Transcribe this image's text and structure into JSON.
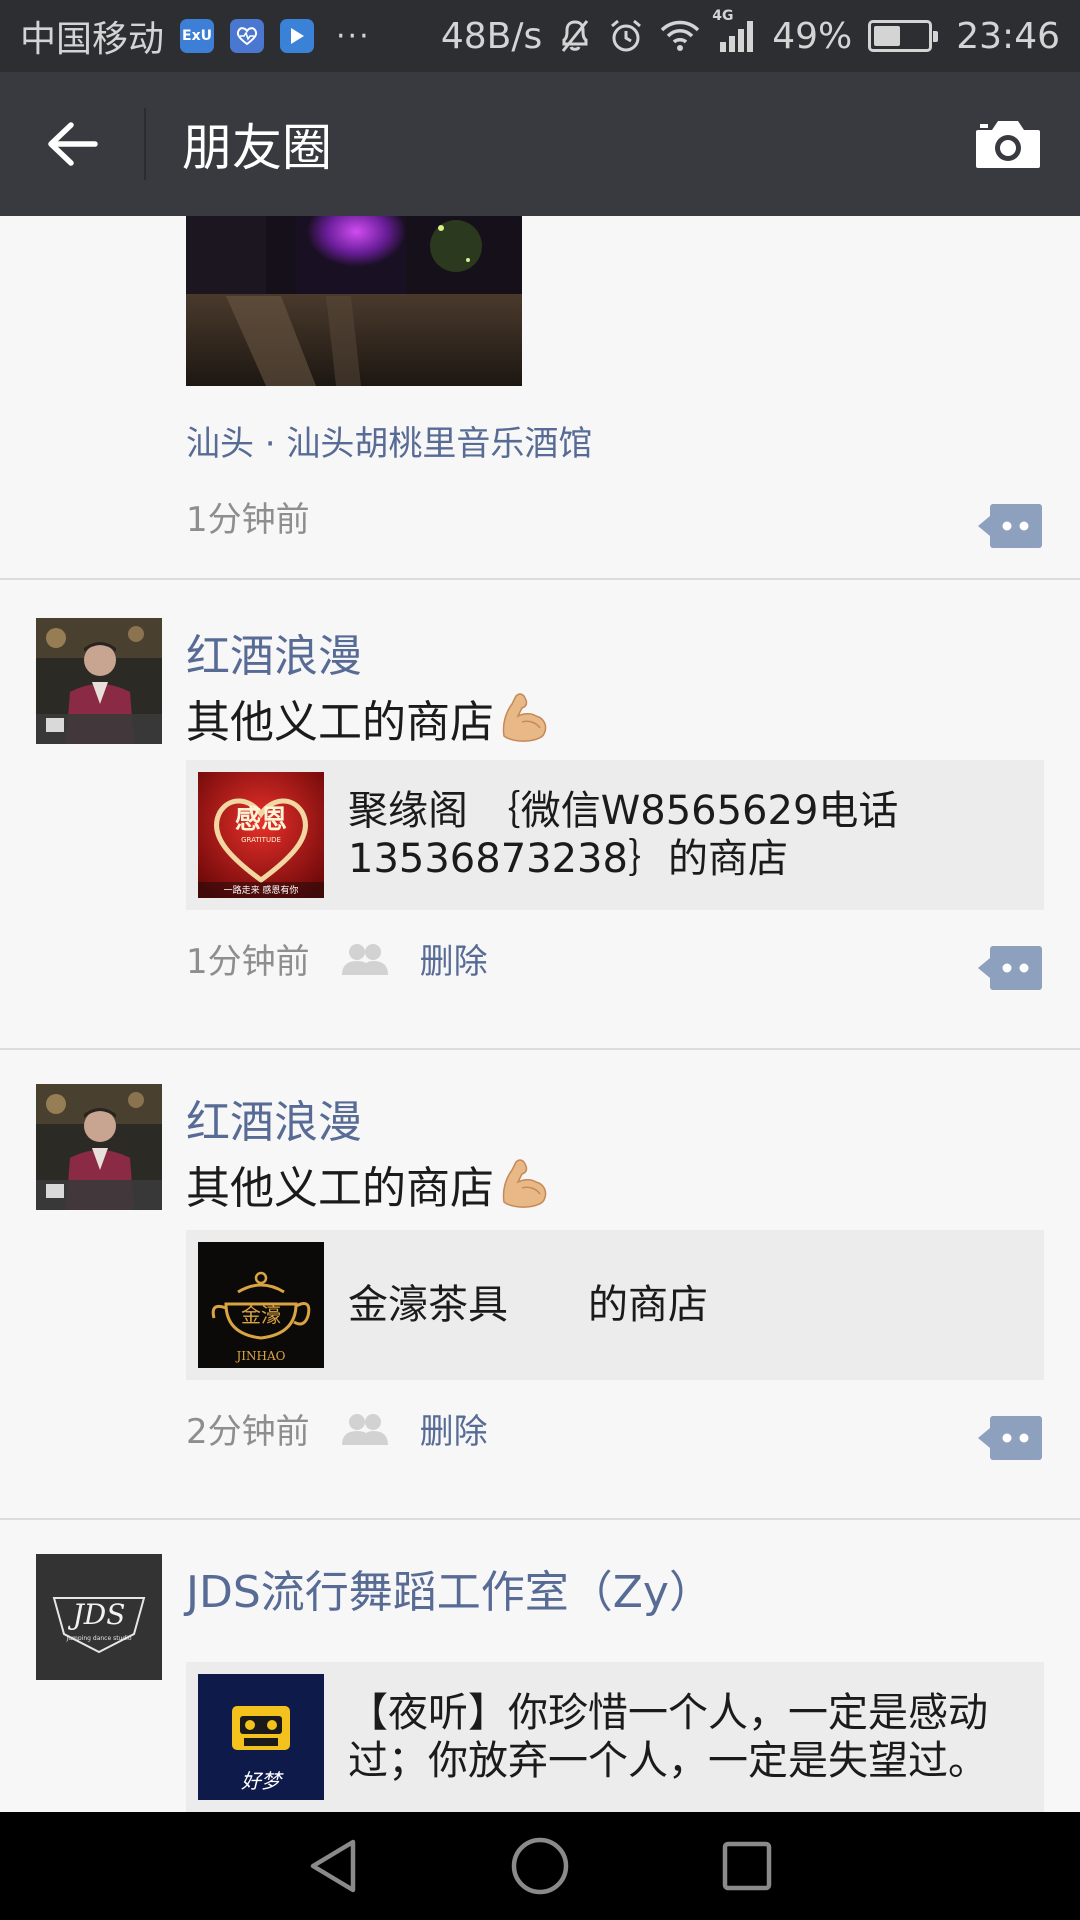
{
  "status_bar": {
    "carrier": "中国移动",
    "app_icons": [
      {
        "name": "exu-app-icon",
        "label": "ExU",
        "color": "#3d7fd6"
      },
      {
        "name": "health-app-icon",
        "label": "",
        "color": "#4a78d0"
      },
      {
        "name": "video-app-icon",
        "label": "",
        "color": "#3a82d8"
      }
    ],
    "more": "···",
    "net_speed": "48B/s",
    "network": "4G",
    "battery_pct": "49%",
    "battery_level": 0.49,
    "time": "23:46"
  },
  "title_bar": {
    "title": "朋友圈"
  },
  "colors": {
    "name_blue": "#576b95",
    "header_bg": "#393a3f",
    "status_bg": "#2d2e32",
    "feed_bg": "#f7f7f8"
  },
  "posts": [
    {
      "location": "汕头 · 汕头胡桃里音乐酒馆",
      "time": "1分钟前"
    },
    {
      "name": "红酒浪漫",
      "text": "其他义工的商店",
      "emoji": "flexed-biceps",
      "card": {
        "thumb_title": "感恩",
        "thumb_sub": "GRATITUDE",
        "thumb_caption": "一路走来 感恩有你",
        "text": "聚缘阁 ｛微信W8565629电话13536873238｝的商店"
      },
      "time": "1分钟前",
      "delete": "删除"
    },
    {
      "name": "红酒浪漫",
      "text": "其他义工的商店",
      "emoji": "flexed-biceps",
      "card": {
        "thumb_title": "金濠",
        "thumb_sub": "JINHAO",
        "text": "金濠茶具　　的商店"
      },
      "time": "2分钟前",
      "delete": "删除"
    },
    {
      "name": "JDS流行舞蹈工作室（Zy）",
      "avatar_text": "JDS",
      "avatar_sub": "Jumping dance studio",
      "card": {
        "thumb_caption": "好梦",
        "text": "【夜听】你珍惜一个人，一定是感动过；你放弃一个人，一定是失望过。"
      }
    }
  ]
}
